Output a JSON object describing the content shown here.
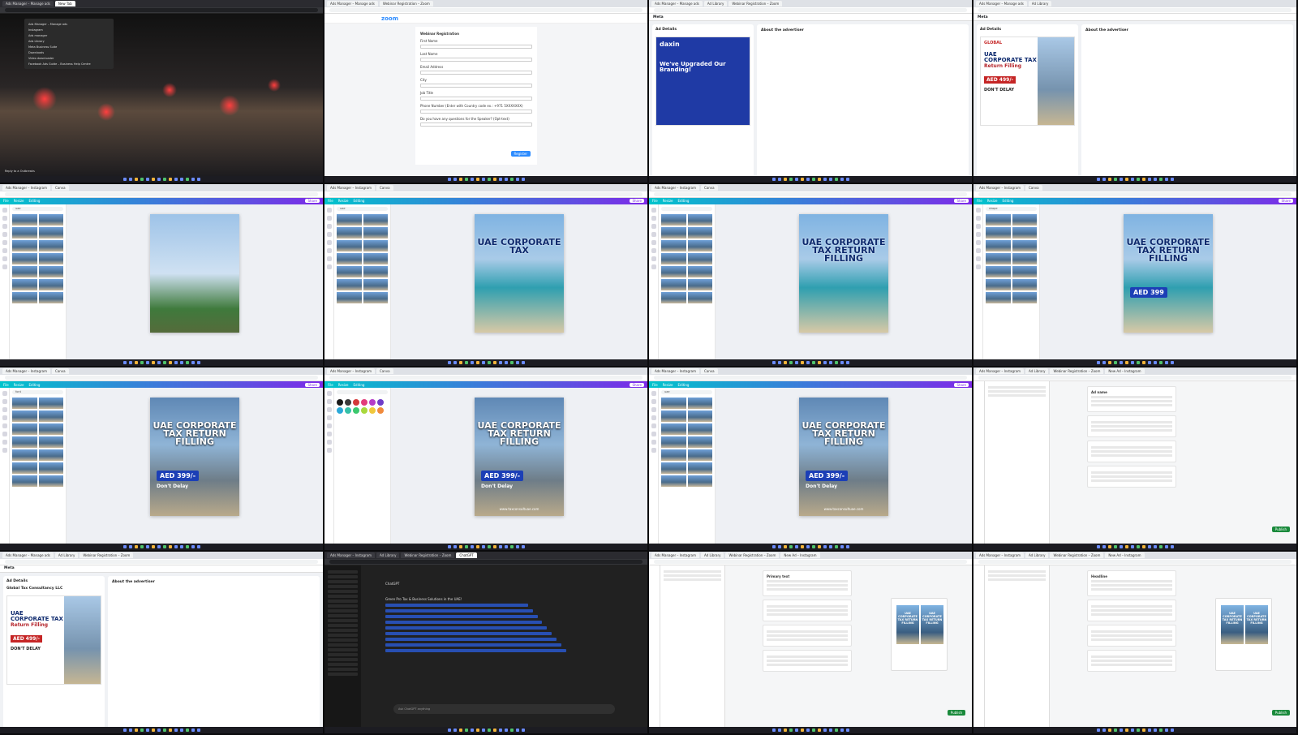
{
  "tiles": [
    {
      "kind": "desktop",
      "tabs": [
        "Ads Manager – Manage ads",
        "New Tab"
      ],
      "menu": [
        "Ads Manager – Manage ads",
        "Instagram",
        "Ads manager",
        "Ads Library",
        "Meta Business Suite",
        "Downloads",
        "Video downloader",
        "Facebook Ads Guide – Business Help Centre"
      ],
      "caption": "Reply to a Outbreaks"
    },
    {
      "kind": "zoom",
      "tabs": [
        "Ads Manager – Manage ads",
        "Webinar Registration – Zoom"
      ],
      "logo": "zoom",
      "form_title": "Webinar Registration",
      "fields": [
        "First Name",
        "Last Name",
        "Email Address",
        "City",
        "Job Title",
        "Phone Number (Enter with Country code ex.: +971 5XXXXXXX)",
        "Do you have any questions for the Speaker? (Opt-text)"
      ],
      "button": "Register"
    },
    {
      "kind": "fbad",
      "tabs": [
        "Ads Manager – Manage ads",
        "Ad Library",
        "Webinar Registration – Zoom"
      ],
      "top": "Meta",
      "panel": "Ad Details",
      "about": "About the advertiser",
      "brand": "daxin",
      "ad_title": "We've Upgraded Our Branding!"
    },
    {
      "kind": "fbad2",
      "tabs": [
        "Ads Manager – Manage ads",
        "Ad Library"
      ],
      "top": "Meta",
      "panel": "Ad Details",
      "about": "About the advertiser",
      "brand": "GLOBAL",
      "t1": "UAE",
      "t2": "CORPORATE TAX",
      "t3": "Return Filling",
      "price": "AED 499/-",
      "delay": "DON'T DELAY"
    },
    {
      "kind": "canva",
      "variant": "museum",
      "tabs": [
        "Ads Manager – Instagram",
        "Canva"
      ],
      "toolbar": [
        "File",
        "Resize",
        "Editing"
      ],
      "share": "Share",
      "search": "uae",
      "title": "",
      "footer": "Add page"
    },
    {
      "kind": "canva",
      "variant": "sea",
      "tabs": [
        "Ads Manager – Instagram",
        "Canva"
      ],
      "toolbar": [
        "File",
        "Resize",
        "Editing"
      ],
      "share": "Share",
      "search": "uae",
      "title": "UAE CORPORATE TAX",
      "footer": "Add page"
    },
    {
      "kind": "canva",
      "variant": "sea",
      "tabs": [
        "Ads Manager – Instagram",
        "Canva"
      ],
      "toolbar": [
        "File",
        "Resize",
        "Editing"
      ],
      "share": "Share",
      "search": "",
      "title": "UAE CORPORATE TAX RETURN FILLING",
      "footer": "Notes"
    },
    {
      "kind": "canva",
      "variant": "sea",
      "tabs": [
        "Ads Manager – Instagram",
        "Canva"
      ],
      "toolbar": [
        "File",
        "Resize",
        "Editing"
      ],
      "share": "Share",
      "search": "shape",
      "title": "UAE CORPORATE TAX RETURN FILLING",
      "price": "AED 399",
      "footer": "Notes"
    },
    {
      "kind": "canva",
      "variant": "city",
      "tabs": [
        "Ads Manager – Instagram",
        "Canva"
      ],
      "toolbar": [
        "File",
        "Resize",
        "Editing"
      ],
      "share": "Share",
      "search": "font",
      "title": "UAE CORPORATE TAX RETURN FILLING",
      "price": "AED 399/-",
      "delay": "Don't Delay",
      "footer": "Notes"
    },
    {
      "kind": "canva-colors",
      "variant": "city",
      "tabs": [
        "Ads Manager – Instagram",
        "Canva"
      ],
      "toolbar": [
        "File",
        "Resize",
        "Editing"
      ],
      "share": "Share",
      "search": "",
      "title": "UAE CORPORATE TAX RETURN FILLING",
      "price": "AED 399/-",
      "delay": "Don't Delay",
      "web": "www.taxconsultuae.com",
      "footer": "Notes",
      "colors": [
        "#1a1a1a",
        "#3b3b3b",
        "#d43a3a",
        "#e23c7a",
        "#b53cc8",
        "#6f3cc8",
        "#2ba8d8",
        "#35c0a8",
        "#3cc86e",
        "#a8d83c",
        "#f0c83c",
        "#f08a3c"
      ]
    },
    {
      "kind": "canva",
      "variant": "city",
      "tabs": [
        "Ads Manager – Instagram",
        "Canva"
      ],
      "toolbar": [
        "File",
        "Resize",
        "Editing"
      ],
      "share": "Share",
      "search": "uae",
      "title": "UAE CORPORATE TAX RETURN FILLING",
      "price": "AED 399/-",
      "delay": "Don't Delay",
      "web": "www.taxconsultuae.com",
      "footer": "Notes"
    },
    {
      "kind": "adsmgr",
      "tabs": [
        "Ads Manager – Instagram",
        "Ad Library",
        "Webinar Registration – Zoom",
        "New Ad – Instagram"
      ],
      "section": "Ad name",
      "pub": "Publish"
    },
    {
      "kind": "fbad3",
      "tabs": [
        "Ads Manager – Manage ads",
        "Ad Library",
        "Webinar Registration – Zoom"
      ],
      "top": "Meta",
      "panel": "Ad Details",
      "about": "About the advertiser",
      "company": "Global Tax Consultancy LLC",
      "t1": "UAE",
      "t2": "CORPORATE TAX",
      "t3": "Return Filling",
      "price": "AED 499/-",
      "delay": "DON'T DELAY"
    },
    {
      "kind": "chatgpt",
      "tabs": [
        "Ads Manager – Instagram",
        "Ad Library",
        "Webinar Registration – Zoom",
        "ChatGPT"
      ],
      "model": "ChatGPT",
      "heading": "Green Pro Tax & Business Solutions in the UAE!",
      "input": "Ask ChatGPT anything"
    },
    {
      "kind": "adsmgr2",
      "tabs": [
        "Ads Manager – Instagram",
        "Ad Library",
        "Webinar Registration – Zoom",
        "New Ad – Instagram"
      ],
      "section": "Primary text",
      "pub": "Publish",
      "mini": "UAE CORPORATE TAX RETURN FILLING"
    },
    {
      "kind": "adsmgr2",
      "tabs": [
        "Ads Manager – Instagram",
        "Ad Library",
        "Webinar Registration – Zoom",
        "New Ad – Instagram"
      ],
      "section": "Headline",
      "pub": "Publish",
      "mini": "UAE CORPORATE TAX RETURN FILLING"
    }
  ]
}
